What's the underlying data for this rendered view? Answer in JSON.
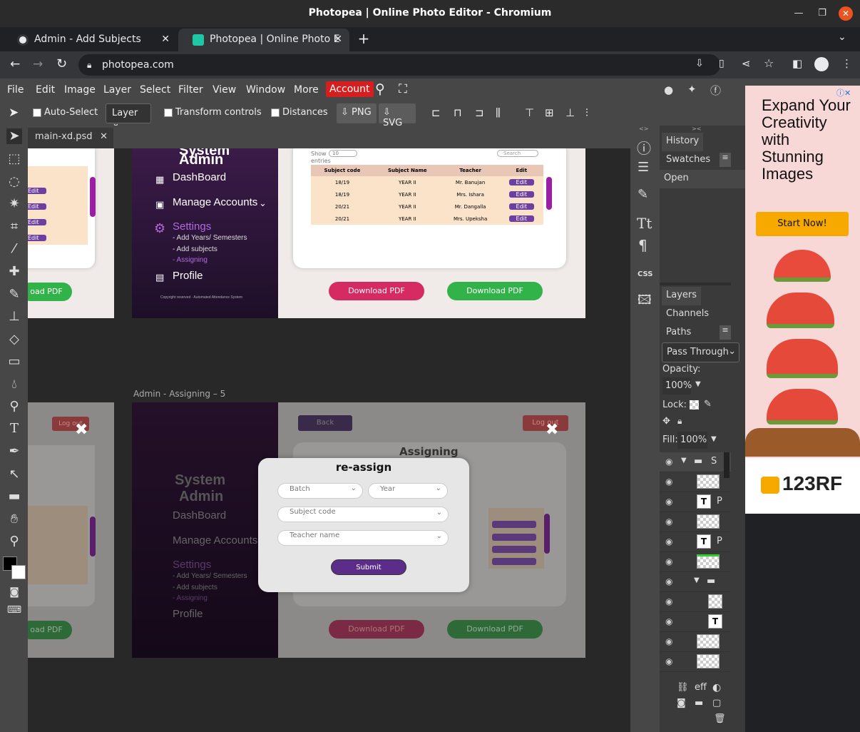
{
  "window": {
    "title": "Photopea | Online Photo Editor - Chromium"
  },
  "tabs": [
    {
      "label": "Admin - Add Subjects",
      "close": "✕"
    },
    {
      "label": "Photopea | Online Photo E",
      "close": "✕"
    }
  ],
  "newtab": "+",
  "address": {
    "url": "photopea.com"
  },
  "menu": {
    "items": [
      "File",
      "Edit",
      "Image",
      "Layer",
      "Select",
      "Filter",
      "View",
      "Window",
      "More"
    ],
    "account": "Account"
  },
  "options": {
    "auto_select": "Auto-Select",
    "layer_select": "Layer",
    "transform": "Transform controls",
    "distances": "Distances",
    "png": "PNG",
    "svg": "SVG"
  },
  "doc": {
    "tab": "main-xd.psd",
    "close": "✕"
  },
  "panels": {
    "history": "History",
    "swatches": "Swatches",
    "history_item": "Open",
    "layers": "Layers",
    "channels": "Channels",
    "paths": "Paths",
    "blend": "Pass Through",
    "opacity_label": "Opacity:",
    "opacity": "100%",
    "lock": "Lock:",
    "fill_label": "Fill:",
    "fill": "100%",
    "group_letter": "S",
    "t_letter": "P",
    "eff": "eff"
  },
  "ad": {
    "headline": "Expand Your Creativity with Stunning Images",
    "cta": "Start Now!",
    "brand": "123RF"
  },
  "top_art": {
    "search": "Search",
    "show": "Show",
    "entries_count": "10",
    "entries": "entries",
    "title1": "System",
    "title2": "Admin",
    "dashboard": "DashBoard",
    "manage": "Manage Accounts",
    "settings": "Settings",
    "sub1": "- Add Years/ Semesters",
    "sub2": "- Add subjects",
    "sub3": "- Assigning",
    "profile": "Profile",
    "footer": "Copyright reserved - Automated Attendance System",
    "download": "Download PDF",
    "download2": "Download PDF",
    "headers": [
      "Subject code",
      "Subject Name",
      "Teacher",
      "Edit"
    ],
    "rows": [
      [
        "18/19",
        "YEAR II",
        "Mr. Banujan",
        "Edit"
      ],
      [
        "18/19",
        "YEAR II",
        "Mrs. Ishara",
        "Edit"
      ],
      [
        "20/21",
        "YEAR II",
        "Mr. Dangalla",
        "Edit"
      ],
      [
        "20/21",
        "YEAR II",
        "Mrs. Upeksha",
        "Edit"
      ]
    ],
    "left_edit": "Edit",
    "left_download": "oad PDF"
  },
  "bottom_art": {
    "label": "Admin - Assigning – 5",
    "back": "Back",
    "logout": "Log out",
    "assigning": "Assigning",
    "modal_title": "re-assign",
    "batch": "Batch",
    "year": "Year",
    "subject": "Subject code",
    "teacher": "Teacher name",
    "submit": "Submit",
    "close_glyph": "✖"
  }
}
